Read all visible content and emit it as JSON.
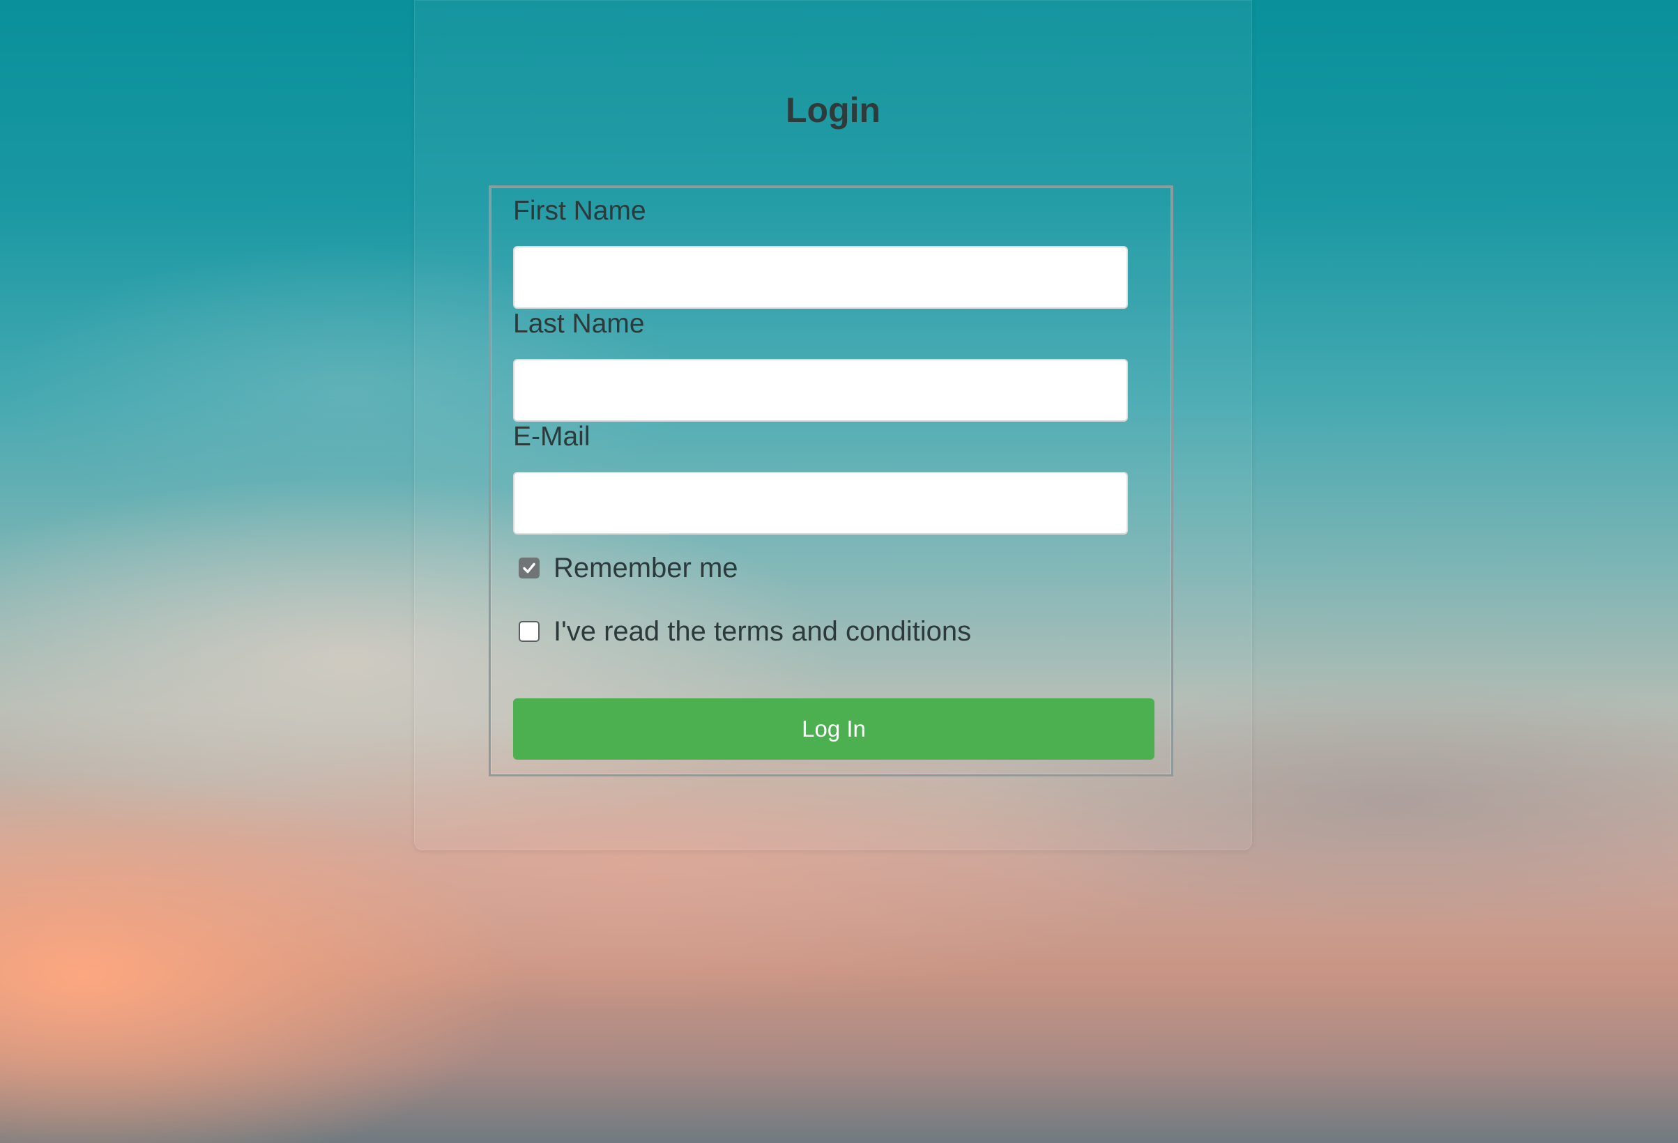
{
  "page": {
    "title": "Login"
  },
  "form": {
    "fields": [
      {
        "label": "First Name",
        "value": "",
        "placeholder": ""
      },
      {
        "label": "Last Name",
        "value": "",
        "placeholder": ""
      },
      {
        "label": "E-Mail",
        "value": "",
        "placeholder": ""
      }
    ],
    "checkboxes": [
      {
        "label": "Remember me",
        "checked": true
      },
      {
        "label": "I've read the terms and conditions",
        "checked": false
      }
    ],
    "submit_label": "Log In"
  },
  "colors": {
    "button": "#4caf50",
    "text": "#2c3a3c"
  },
  "icons": {
    "checkmark": "check-icon"
  }
}
